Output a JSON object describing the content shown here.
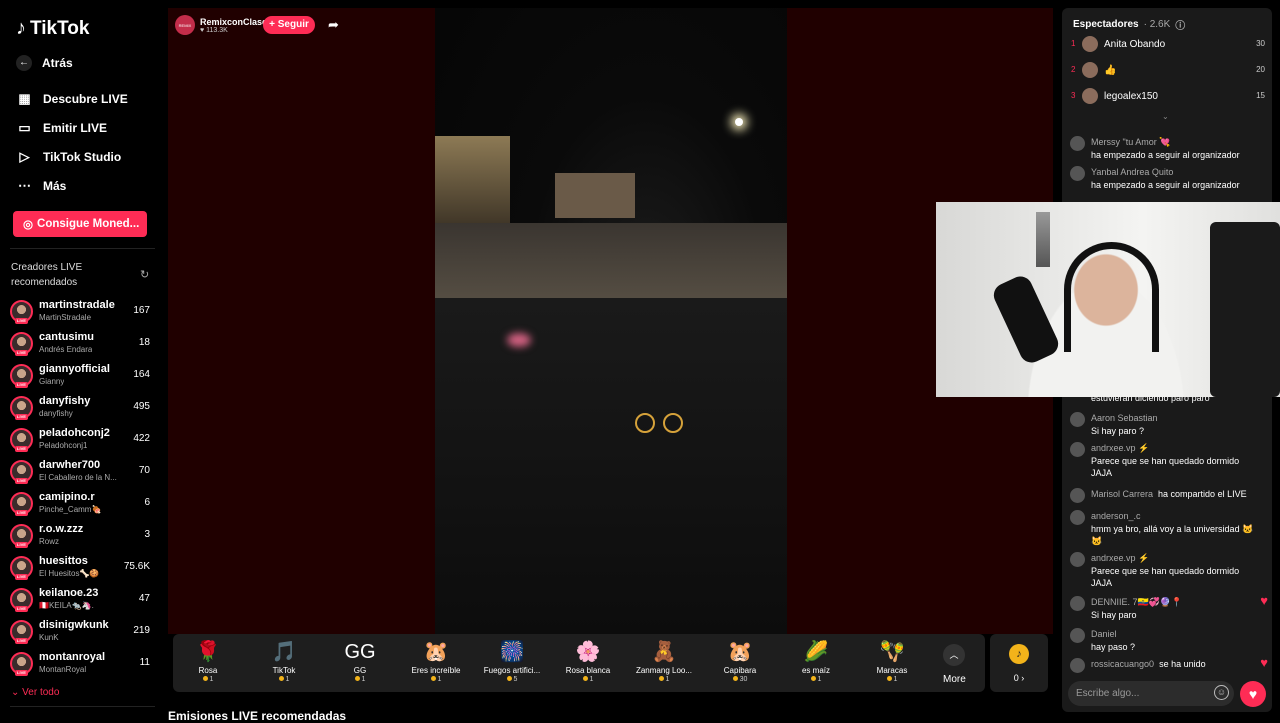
{
  "brand": {
    "name": "TikTok"
  },
  "nav": {
    "back": "Atrás",
    "items": [
      {
        "label": "Descubre LIVE",
        "icon": "calendar-icon"
      },
      {
        "label": "Emitir LIVE",
        "icon": "camera-icon"
      },
      {
        "label": "TikTok Studio",
        "icon": "play-icon"
      },
      {
        "label": "Más",
        "icon": "more-icon"
      }
    ],
    "coins_button": "Consigue Moned..."
  },
  "recommended": {
    "title": "Creadores LIVE recomendados",
    "see_all": "Ver todo",
    "live_badge": "LIVE",
    "creators": [
      {
        "name": "martinstradale",
        "sub": "MartinStradale",
        "count": "167"
      },
      {
        "name": "cantusimu",
        "sub": "Andrés Endara",
        "count": "18"
      },
      {
        "name": "giannyofficial",
        "sub": "Gianny",
        "count": "164"
      },
      {
        "name": "danyfishy",
        "sub": "danyfishy",
        "count": "495"
      },
      {
        "name": "peladohconj2",
        "sub": "Peladohconj1",
        "count": "422"
      },
      {
        "name": "darwher700",
        "sub": "El Caballero de la N...",
        "count": "70"
      },
      {
        "name": "camipino.r",
        "sub": "Pinche_Camm🍖",
        "count": "6"
      },
      {
        "name": "r.o.w.zzz",
        "sub": "Rowz",
        "count": "3"
      },
      {
        "name": "huesittos",
        "sub": "El Huesitos🦴🍪",
        "count": "75.6K"
      },
      {
        "name": "keilanoe.23",
        "sub": "🇵🇪KEILA🐀🦄.",
        "count": "47"
      },
      {
        "name": "disinigwkunk",
        "sub": "KunK",
        "count": "219"
      },
      {
        "name": "montanroyal",
        "sub": "MontanRoyal",
        "count": "11"
      }
    ]
  },
  "stream": {
    "host_name": "RemixconClase",
    "host_likes": "113.3K",
    "host_avatar_text": "REMIX",
    "follow_label": "+ Seguir",
    "below_title": "Emisiones LIVE recomendadas"
  },
  "gifts": [
    {
      "name": "Rosa",
      "price": "1",
      "icon": "🌹"
    },
    {
      "name": "TikTok",
      "price": "1",
      "icon": "🎵"
    },
    {
      "name": "GG",
      "price": "1",
      "icon": "GG"
    },
    {
      "name": "Eres increíble",
      "price": "1",
      "icon": "🐹"
    },
    {
      "name": "Fuegos artifici...",
      "price": "5",
      "icon": "🎆"
    },
    {
      "name": "Rosa blanca",
      "price": "1",
      "icon": "🌸"
    },
    {
      "name": "Zanmang Loo...",
      "price": "1",
      "icon": "🧸"
    },
    {
      "name": "Capibara",
      "price": "30",
      "icon": "🐹"
    },
    {
      "name": "es maíz",
      "price": "1",
      "icon": "🌽"
    },
    {
      "name": "Maracas",
      "price": "1",
      "icon": "🪇"
    }
  ],
  "gifts_more": "More",
  "coins_balance": "0 ›",
  "chat": {
    "viewers_label": "Espectadores",
    "viewers_count": "2.6K",
    "top_viewers": [
      {
        "rank": "1",
        "name": "Anita Obando",
        "points": "30"
      },
      {
        "rank": "2",
        "name": "👍",
        "points": "20"
      },
      {
        "rank": "3",
        "name": "legoalex150",
        "points": "15"
      }
    ],
    "messages": [
      {
        "user": "Merssy \"tu Amor 💘",
        "text": "ha empezado a seguir al organizador"
      },
      {
        "user": "Yanbal Andrea Quito",
        "text": "ha empezado a seguir al organizador"
      },
      {
        "user": "",
        "text": "estuvieran diciendo paro paro"
      },
      {
        "user": "Aaron Sebastian",
        "text": "Si hay paro ?"
      },
      {
        "user": "andrxee.vp ⚡",
        "text": "Parece que se han quedado dormido JAJA"
      },
      {
        "user": "Marisol Carrera",
        "text": "ha compartido el LIVE"
      },
      {
        "user": "anderson_.c",
        "text": "hmm ya bro, allá voy a la universidad 🐱🐱"
      },
      {
        "user": "andrxee.vp ⚡",
        "text": "Parece que se han quedado dormido JAJA"
      },
      {
        "user": "DENNIIE. 7🇪🇨💞🔮📍",
        "text": "Si hay paro"
      },
      {
        "user": "Daniel",
        "text": "hay paso ?"
      },
      {
        "user": "rossicacuango0",
        "text": "se ha unido"
      }
    ],
    "input_placeholder": "Escribe algo..."
  }
}
